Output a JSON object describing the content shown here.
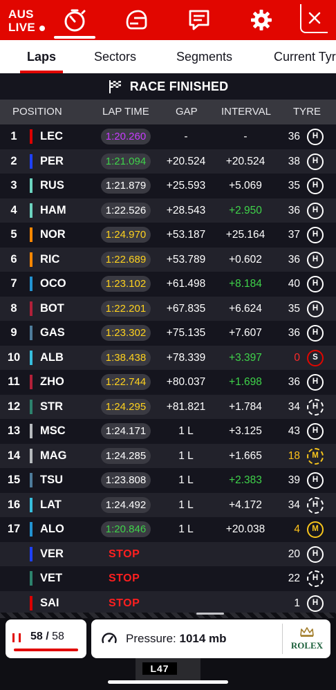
{
  "session": {
    "code": "AUS",
    "status": "LIVE"
  },
  "topbar_icons": [
    "timer-icon",
    "helmet-icon",
    "chat-icon",
    "gear-icon",
    "close-icon"
  ],
  "tabs": [
    {
      "label": "Laps",
      "active": true
    },
    {
      "label": "Sectors",
      "active": false
    },
    {
      "label": "Segments",
      "active": false
    },
    {
      "label": "Current Tyre",
      "active": false
    }
  ],
  "banner": {
    "text": "RACE FINISHED",
    "icon": "checkered-flag-icon"
  },
  "columns": {
    "position": "POSITION",
    "lap_time": "LAP TIME",
    "gap": "GAP",
    "interval": "INTERVAL",
    "tyre": "TYRE"
  },
  "rows": [
    {
      "pos": "1",
      "driver": "LEC",
      "team_color": "#dc0000",
      "lap_time": "1:20.260",
      "lt_color": "purple",
      "gap": "-",
      "interval": "-",
      "int_green": false,
      "laps": "36",
      "laps_color": "",
      "tyre": "H",
      "tyre_used": false
    },
    {
      "pos": "2",
      "driver": "PER",
      "team_color": "#1e41ff",
      "lap_time": "1:21.094",
      "lt_color": "green",
      "gap": "+20.524",
      "interval": "+20.524",
      "int_green": false,
      "laps": "38",
      "laps_color": "",
      "tyre": "H",
      "tyre_used": false
    },
    {
      "pos": "3",
      "driver": "RUS",
      "team_color": "#6cd3bf",
      "lap_time": "1:21.879",
      "lt_color": "white",
      "gap": "+25.593",
      "interval": "+5.069",
      "int_green": false,
      "laps": "35",
      "laps_color": "",
      "tyre": "H",
      "tyre_used": false
    },
    {
      "pos": "4",
      "driver": "HAM",
      "team_color": "#6cd3bf",
      "lap_time": "1:22.526",
      "lt_color": "white",
      "gap": "+28.543",
      "interval": "+2.950",
      "int_green": true,
      "laps": "36",
      "laps_color": "",
      "tyre": "H",
      "tyre_used": false
    },
    {
      "pos": "5",
      "driver": "NOR",
      "team_color": "#ff8700",
      "lap_time": "1:24.970",
      "lt_color": "yellow",
      "gap": "+53.187",
      "interval": "+25.164",
      "int_green": false,
      "laps": "37",
      "laps_color": "",
      "tyre": "H",
      "tyre_used": false
    },
    {
      "pos": "6",
      "driver": "RIC",
      "team_color": "#ff8700",
      "lap_time": "1:22.689",
      "lt_color": "yellow",
      "gap": "+53.789",
      "interval": "+0.602",
      "int_green": false,
      "laps": "36",
      "laps_color": "",
      "tyre": "H",
      "tyre_used": false
    },
    {
      "pos": "7",
      "driver": "OCO",
      "team_color": "#2293d1",
      "lap_time": "1:23.102",
      "lt_color": "yellow",
      "gap": "+61.498",
      "interval": "+8.184",
      "int_green": true,
      "laps": "40",
      "laps_color": "",
      "tyre": "H",
      "tyre_used": false
    },
    {
      "pos": "8",
      "driver": "BOT",
      "team_color": "#b12039",
      "lap_time": "1:22.201",
      "lt_color": "yellow",
      "gap": "+67.835",
      "interval": "+6.624",
      "int_green": false,
      "laps": "35",
      "laps_color": "",
      "tyre": "H",
      "tyre_used": false
    },
    {
      "pos": "9",
      "driver": "GAS",
      "team_color": "#4e7c9b",
      "lap_time": "1:23.302",
      "lt_color": "yellow",
      "gap": "+75.135",
      "interval": "+7.607",
      "int_green": false,
      "laps": "36",
      "laps_color": "",
      "tyre": "H",
      "tyre_used": false
    },
    {
      "pos": "10",
      "driver": "ALB",
      "team_color": "#37bedd",
      "lap_time": "1:38.438",
      "lt_color": "yellow",
      "gap": "+78.339",
      "interval": "+3.397",
      "int_green": true,
      "laps": "0",
      "laps_color": "red",
      "tyre": "S",
      "tyre_used": false
    },
    {
      "pos": "11",
      "driver": "ZHO",
      "team_color": "#b12039",
      "lap_time": "1:22.744",
      "lt_color": "yellow",
      "gap": "+80.037",
      "interval": "+1.698",
      "int_green": true,
      "laps": "36",
      "laps_color": "",
      "tyre": "H",
      "tyre_used": false
    },
    {
      "pos": "12",
      "driver": "STR",
      "team_color": "#2d826d",
      "lap_time": "1:24.295",
      "lt_color": "yellow",
      "gap": "+81.821",
      "interval": "+1.784",
      "int_green": false,
      "laps": "34",
      "laps_color": "",
      "tyre": "H",
      "tyre_used": true
    },
    {
      "pos": "13",
      "driver": "MSC",
      "team_color": "#b6babd",
      "lap_time": "1:24.171",
      "lt_color": "white",
      "gap": "1 L",
      "interval": "+3.125",
      "int_green": false,
      "laps": "43",
      "laps_color": "",
      "tyre": "H",
      "tyre_used": false
    },
    {
      "pos": "14",
      "driver": "MAG",
      "team_color": "#b6babd",
      "lap_time": "1:24.285",
      "lt_color": "white",
      "gap": "1 L",
      "interval": "+1.665",
      "int_green": false,
      "laps": "18",
      "laps_color": "yellow",
      "tyre": "M",
      "tyre_used": true
    },
    {
      "pos": "15",
      "driver": "TSU",
      "team_color": "#4e7c9b",
      "lap_time": "1:23.808",
      "lt_color": "white",
      "gap": "1 L",
      "interval": "+2.383",
      "int_green": true,
      "laps": "39",
      "laps_color": "",
      "tyre": "H",
      "tyre_used": false
    },
    {
      "pos": "16",
      "driver": "LAT",
      "team_color": "#37bedd",
      "lap_time": "1:24.492",
      "lt_color": "white",
      "gap": "1 L",
      "interval": "+4.172",
      "int_green": false,
      "laps": "34",
      "laps_color": "",
      "tyre": "H",
      "tyre_used": true
    },
    {
      "pos": "17",
      "driver": "ALO",
      "team_color": "#2293d1",
      "lap_time": "1:20.846",
      "lt_color": "green",
      "gap": "1 L",
      "interval": "+20.038",
      "int_green": false,
      "laps": "4",
      "laps_color": "yellow",
      "tyre": "M",
      "tyre_used": false
    },
    {
      "pos": "",
      "driver": "VER",
      "team_color": "#1e41ff",
      "lap_time": "STOP",
      "lt_color": "stop",
      "gap": "",
      "interval": "",
      "int_green": false,
      "laps": "20",
      "laps_color": "",
      "tyre": "H",
      "tyre_used": false
    },
    {
      "pos": "",
      "driver": "VET",
      "team_color": "#2d826d",
      "lap_time": "STOP",
      "lt_color": "stop",
      "gap": "",
      "interval": "",
      "int_green": false,
      "laps": "22",
      "laps_color": "",
      "tyre": "H",
      "tyre_used": true
    },
    {
      "pos": "",
      "driver": "SAI",
      "team_color": "#dc0000",
      "lap_time": "STOP",
      "lt_color": "stop",
      "gap": "",
      "interval": "",
      "int_green": false,
      "laps": "1",
      "laps_color": "",
      "tyre": "H",
      "tyre_used": false
    }
  ],
  "lap_counter": {
    "current": "58",
    "separator": "/",
    "total": "58",
    "progress": 1.0
  },
  "pressure": {
    "label": "Pressure:",
    "value": "1014 mb"
  },
  "sponsor": {
    "name": "ROLEX"
  },
  "onboard": {
    "label": "L47"
  },
  "colors": {
    "brand_red": "#e10600",
    "purple": "#c83cff",
    "green": "#3fd34a",
    "yellow": "#ffd21e"
  }
}
